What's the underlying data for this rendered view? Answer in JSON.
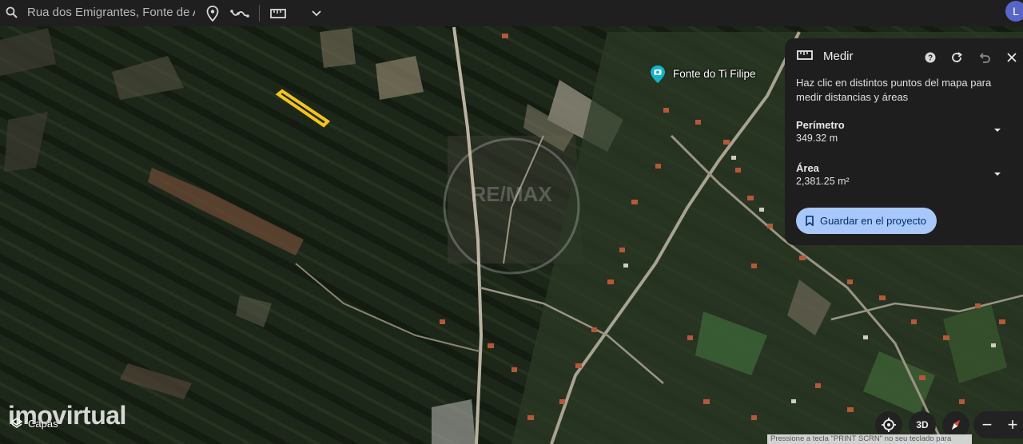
{
  "topbar": {
    "search_value": "Rua dos Emigrantes, Fonte de Ang",
    "avatar_letter": "L"
  },
  "measure_panel": {
    "title": "Medir",
    "description": "Haz clic en distintos puntos del mapa para medir distancias y áreas",
    "perimeter_label": "Perímetro",
    "perimeter_value": "349.32 m",
    "area_label": "Área",
    "area_value": "2,381.25 m²",
    "save_label": "Guardar en el proyecto"
  },
  "map": {
    "poi_label": "Fonte do Ti Filipe",
    "watermark_center": "RE/MAX",
    "measured_shape_color": "#f5c518",
    "poi_color": "#12b5cb"
  },
  "overlay": {
    "brand_logo": "imovirtual",
    "layers_label": "Capas",
    "view_3d_label": "3D",
    "zoom_out": "−",
    "zoom_in": "+",
    "notice_text": "Pressione a tecla \"PRINT SCRN\" no seu teclado para"
  },
  "icons": {
    "search": "search-icon",
    "pin": "pin-icon",
    "path": "path-icon",
    "ruler": "ruler-icon",
    "chevron": "chevron-down-icon",
    "help": "help-icon",
    "reset": "reset-icon",
    "undo": "undo-icon",
    "close": "close-icon",
    "bookmark": "bookmark-icon",
    "layers": "layers-icon",
    "locate": "locate-icon",
    "compass": "compass-icon"
  }
}
